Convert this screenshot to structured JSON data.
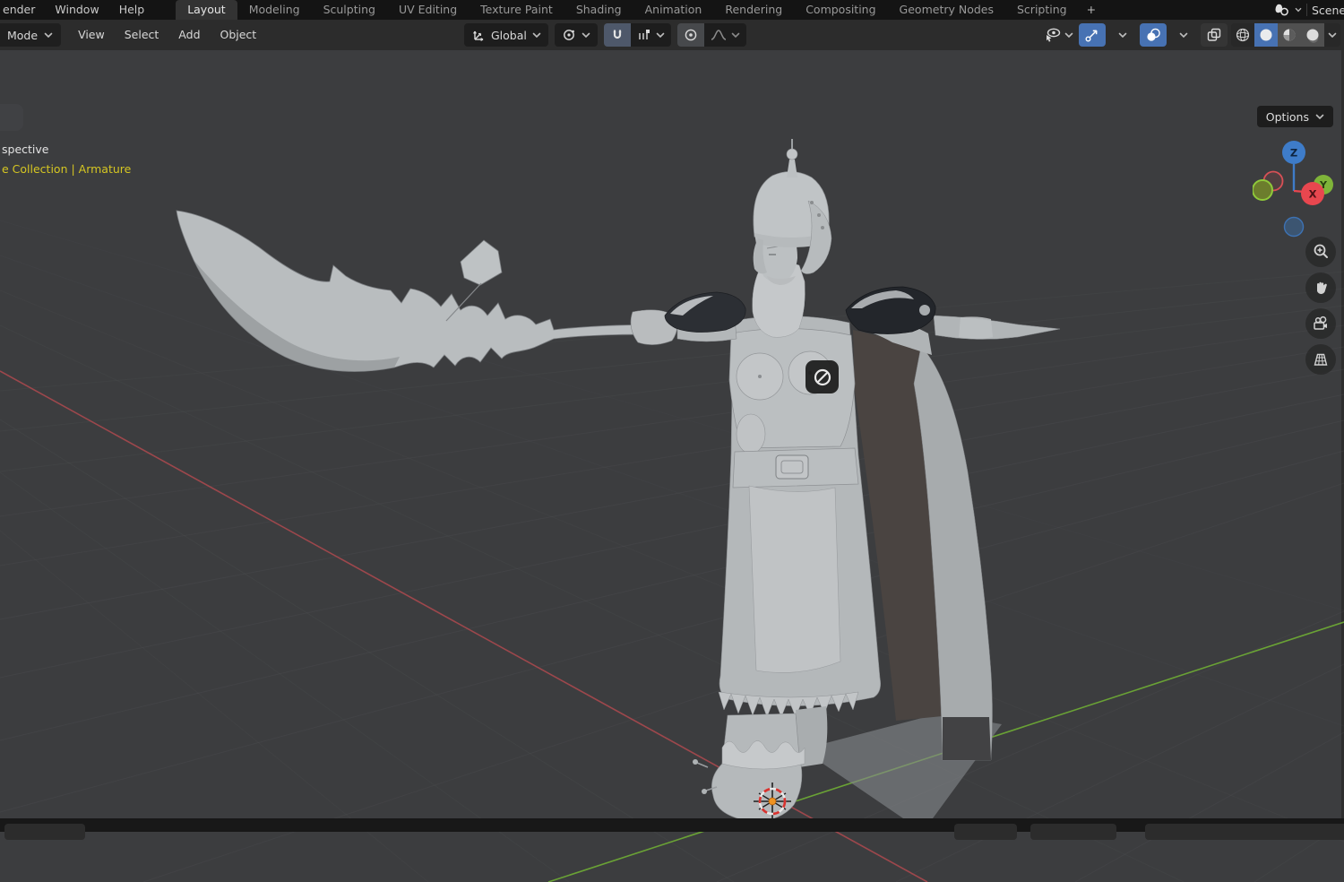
{
  "topbar": {
    "menus": [
      {
        "label": "ender"
      },
      {
        "label": "Window"
      },
      {
        "label": "Help"
      }
    ],
    "tabs": [
      {
        "label": "Layout",
        "active": true
      },
      {
        "label": "Modeling",
        "active": false
      },
      {
        "label": "Sculpting",
        "active": false
      },
      {
        "label": "UV Editing",
        "active": false
      },
      {
        "label": "Texture Paint",
        "active": false
      },
      {
        "label": "Shading",
        "active": false
      },
      {
        "label": "Animation",
        "active": false
      },
      {
        "label": "Rendering",
        "active": false
      },
      {
        "label": "Compositing",
        "active": false
      },
      {
        "label": "Geometry Nodes",
        "active": false
      },
      {
        "label": "Scripting",
        "active": false
      }
    ],
    "new_tab_label": "+",
    "scene": {
      "label": "Scene"
    }
  },
  "tool_header": {
    "mode": {
      "label": "Mode"
    },
    "menus": [
      {
        "label": "View"
      },
      {
        "label": "Select"
      },
      {
        "label": "Add"
      },
      {
        "label": "Object"
      }
    ],
    "orientation": {
      "label": "Global"
    }
  },
  "viewport": {
    "overlay": {
      "line1": "spective",
      "line2": "e Collection | Armature"
    },
    "options": {
      "label": "Options"
    },
    "gizmo": {
      "x": "X",
      "y": "Y",
      "z": "Z"
    }
  },
  "icons": {
    "scene-icon": "shapes-glyph",
    "transform-orientation-icon": "axes-arrows",
    "pivot-point-icon": "circle-orbit-dot",
    "magnet-icon": "snap-magnet",
    "snap-target-icon": "increment-ticks",
    "proportional-editing-icon": "circle-dot",
    "falloff-curve-icon": "bell-curve",
    "visibility-icon": "eye-cursor",
    "gizmo-toggle-icon": "arrow-circle",
    "overlays-icon": "two-circles",
    "xray-icon": "overlapping-squares",
    "wireframe-shading-icon": "wire-sphere",
    "solid-shading-icon": "solid-sphere",
    "material-shading-icon": "checker-sphere",
    "rendered-shading-icon": "shaded-sphere",
    "zoom-icon": "magnifier-plus",
    "pan-hand-icon": "hand",
    "camera-view-icon": "movie-camera",
    "ortho-grid-icon": "perspective-grid",
    "disabled-cursor-icon": "circle-slash",
    "cursor-3d-icon": "dashed-circle-crosshair"
  },
  "colors": {
    "accent_blue": "#4772b3",
    "axis_x_red": "#a8494e",
    "axis_y_green": "#6fae35",
    "gizmo_x": "#e8474f",
    "gizmo_y": "#7fb439",
    "gizmo_z": "#3e7cc9",
    "selection_yellow": "#d5c622",
    "viewport_bg": "#3c3d3f",
    "topbar_bg": "#141414",
    "header_bg": "#2c2c2c"
  }
}
